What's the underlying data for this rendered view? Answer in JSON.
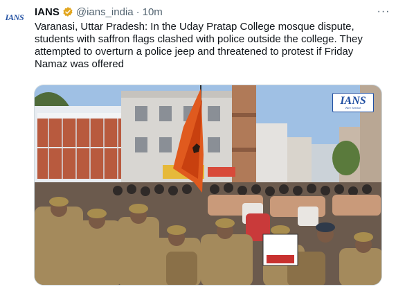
{
  "account": {
    "avatar_text": "IANS",
    "display_name": "IANS",
    "handle": "@ians_india",
    "separator": "·",
    "time": "10m",
    "verified_badge_color": "#e2a61f"
  },
  "menu": {
    "more_icon": "more-horizontal-icon",
    "more_glyph": "···"
  },
  "tweet": {
    "text": "Varanasi, Uttar Pradesh: In the Uday Pratap College mosque dispute, students with saffron flags clashed with police outside the college. They attempted to overturn a police jeep and threatened to protest if Friday Namaz was offered"
  },
  "media": {
    "watermark_main": "IANS",
    "watermark_sub": "Wire Service",
    "brand_color": "#1f4ea1"
  }
}
